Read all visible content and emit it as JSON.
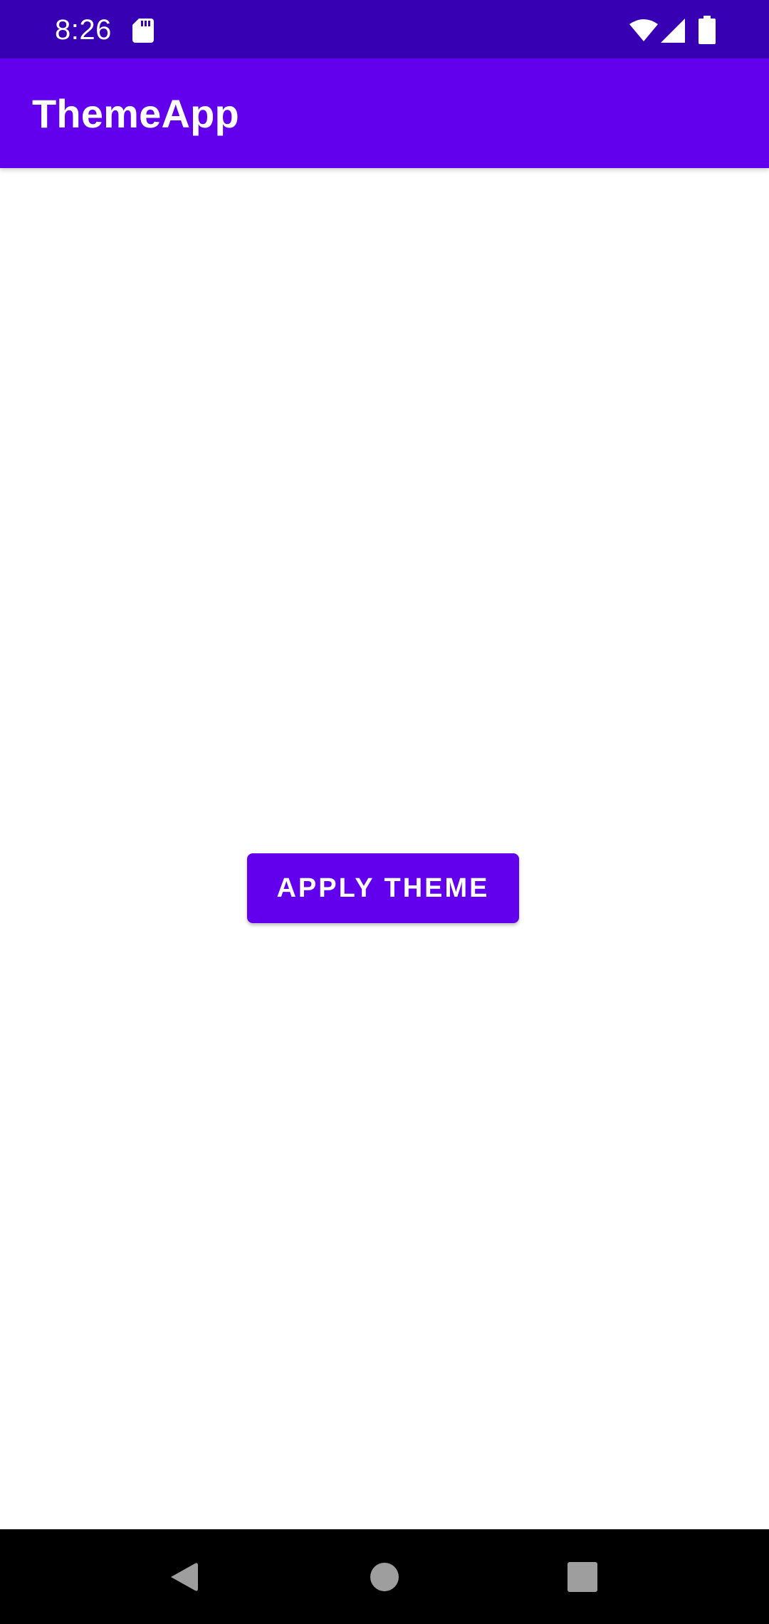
{
  "status_bar": {
    "time": "8:26",
    "icons": [
      "sd-card-icon",
      "wifi-icon",
      "cell-signal-icon",
      "battery-icon"
    ]
  },
  "app_bar": {
    "title": "ThemeApp"
  },
  "main": {
    "apply_button_label": "Apply Theme"
  },
  "nav_bar": {
    "icons": [
      "back-icon",
      "home-icon",
      "recents-icon"
    ]
  },
  "colors": {
    "status_bar": "#3700b3",
    "primary": "#6200ee",
    "background": "#ffffff",
    "nav_bar": "#000000",
    "nav_icon": "#9e9e9e"
  }
}
